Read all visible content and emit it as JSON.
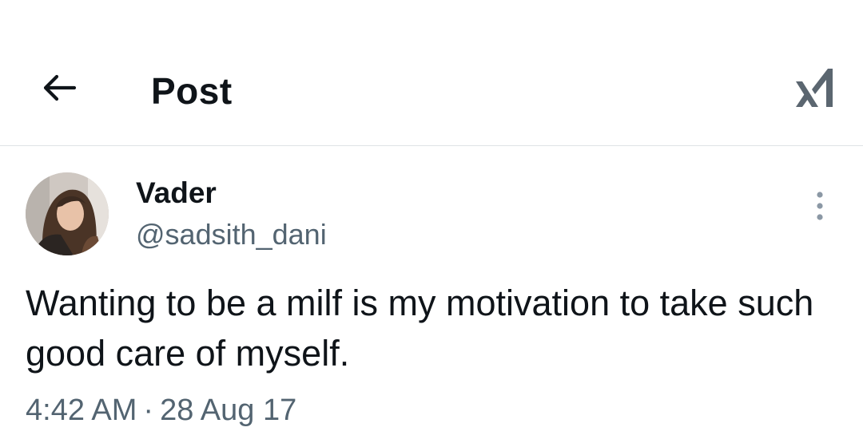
{
  "header": {
    "title": "Post",
    "back_icon": "arrow-left-icon",
    "grok_icon": "grok-icon"
  },
  "post": {
    "author": {
      "display_name": "Vader",
      "handle": "@sadsith_dani"
    },
    "text": "Wanting to be a milf is my motivation to take such good care of myself.",
    "time": "4:42 AM",
    "separator": "·",
    "date": "28 Aug 17",
    "more_icon": "more-vertical-icon"
  },
  "colors": {
    "text_primary": "#0f1419",
    "text_secondary": "#536471",
    "divider": "#dfe3e6",
    "icon_gray": "#5b6670"
  }
}
